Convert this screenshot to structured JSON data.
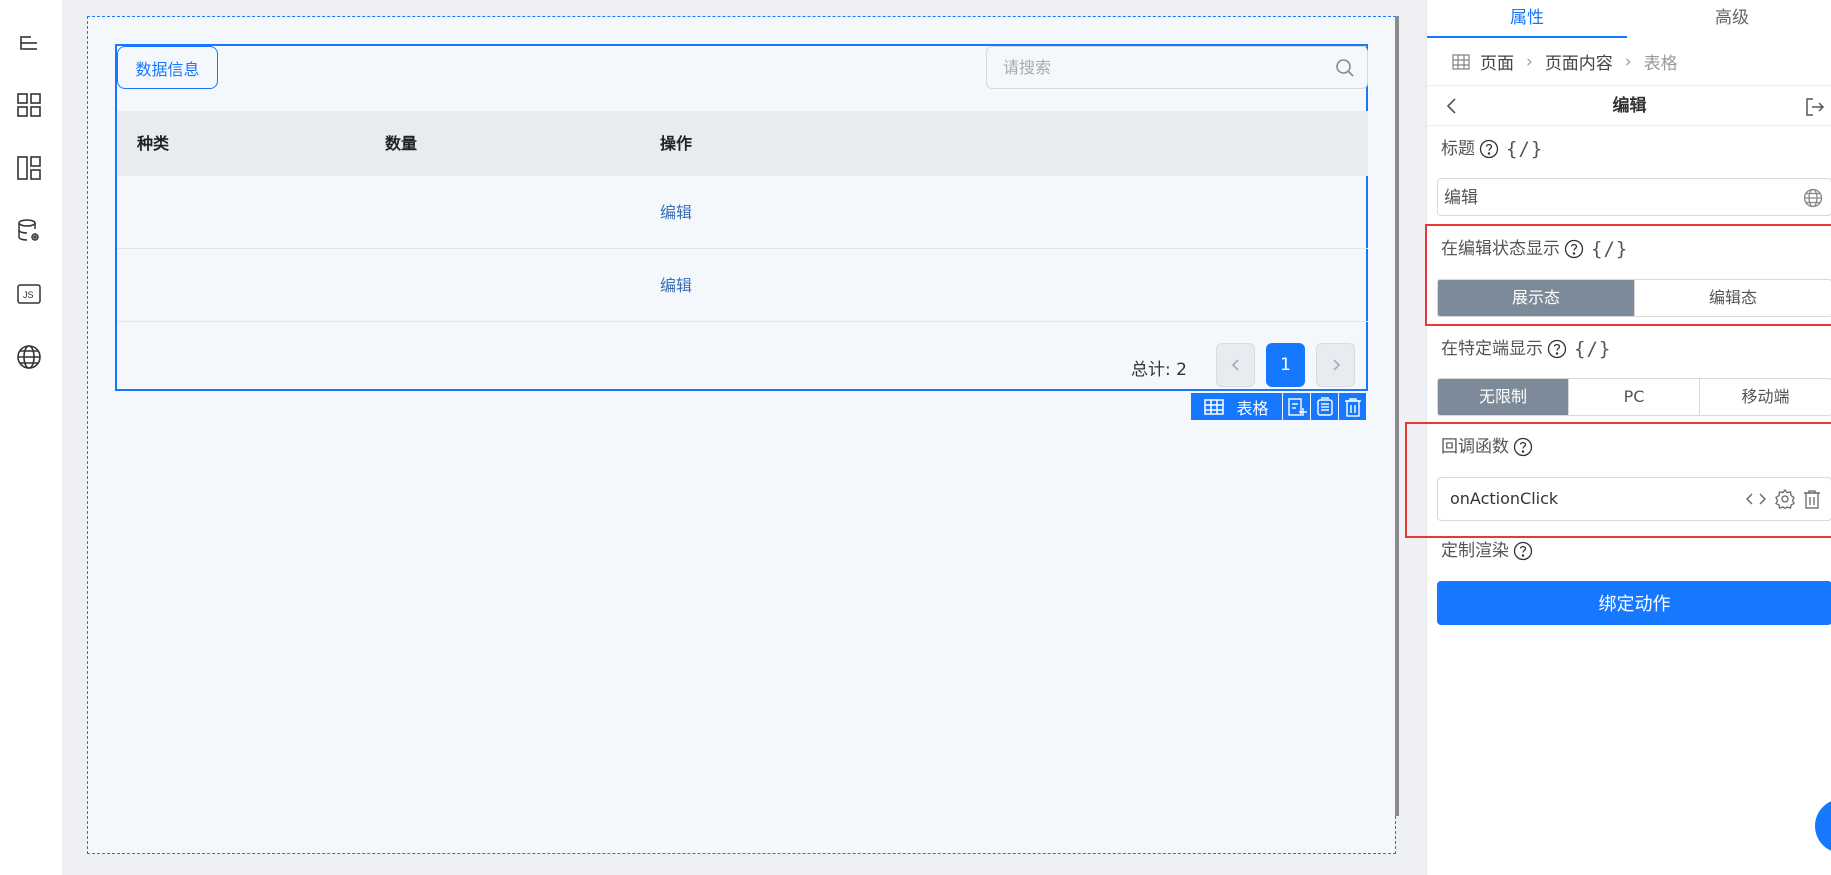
{
  "table": {
    "tab_label": "数据信息",
    "search_placeholder": "请搜索",
    "columns": [
      "种类",
      "数量",
      "操作"
    ],
    "rows": [
      {
        "type": "",
        "qty": "",
        "action": "编辑"
      },
      {
        "type": "",
        "qty": "",
        "action": "编辑"
      }
    ],
    "total_text": "总计: 2",
    "current_page": "1"
  },
  "component_bar": {
    "label": "表格"
  },
  "panel": {
    "tabs": [
      "属性",
      "高级"
    ],
    "active_tab": "属性",
    "breadcrumb": [
      "页面",
      "页面内容",
      "表格"
    ],
    "edit_title": "编辑",
    "title_section": {
      "label": "标题",
      "value": "编辑",
      "brace": "{/}"
    },
    "edit_state_section": {
      "label": "在编辑状态显示",
      "brace": "{/}",
      "options": [
        "展示态",
        "编辑态"
      ],
      "selected": "展示态"
    },
    "terminal_section": {
      "label": "在特定端显示",
      "brace": "{/}",
      "options": [
        "无限制",
        "PC",
        "移动端"
      ],
      "selected": "无限制"
    },
    "callback_section": {
      "label": "回调函数",
      "value": "onActionClick"
    },
    "custom_render_label": "定制渲染",
    "bind_button": "绑定动作"
  },
  "colors": {
    "primary": "#1677ff",
    "segment_active": "#7d8a99",
    "highlight_border": "#e53935"
  }
}
